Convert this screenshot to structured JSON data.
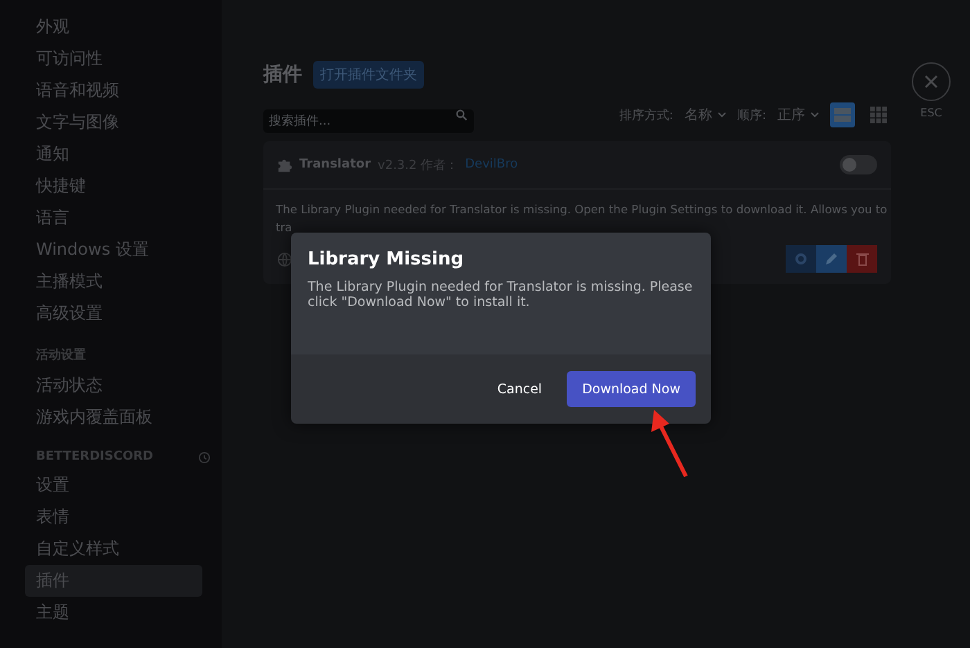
{
  "sidebar": {
    "groups": [
      {
        "items": [
          {
            "label": "外观",
            "selected": false
          },
          {
            "label": "可访问性",
            "selected": false
          },
          {
            "label": "语音和视频",
            "selected": false
          },
          {
            "label": "文字与图像",
            "selected": false
          },
          {
            "label": "通知",
            "selected": false
          },
          {
            "label": "快捷键",
            "selected": false
          },
          {
            "label": "语言",
            "selected": false
          },
          {
            "label": "Windows 设置",
            "selected": false
          },
          {
            "label": "主播模式",
            "selected": false
          },
          {
            "label": "高级设置",
            "selected": false
          }
        ]
      },
      {
        "header": "活动设置",
        "items": [
          {
            "label": "活动状态",
            "selected": false
          },
          {
            "label": "游戏内覆盖面板",
            "selected": false
          }
        ]
      },
      {
        "header": "BETTERDISCORD",
        "items": [
          {
            "label": "设置",
            "selected": false
          },
          {
            "label": "表情",
            "selected": false
          },
          {
            "label": "自定义样式",
            "selected": false
          },
          {
            "label": "插件",
            "selected": true
          },
          {
            "label": "主题",
            "selected": false
          }
        ]
      }
    ]
  },
  "page": {
    "title": "插件",
    "open_folder_button": "打开插件文件夹",
    "search": {
      "placeholder": "搜索插件..."
    },
    "sort": {
      "label": "排序方式:",
      "value": "名称"
    },
    "order": {
      "label": "顺序:",
      "value": "正序"
    },
    "views": [
      {
        "kind": "list",
        "selected": true
      },
      {
        "kind": "grid",
        "selected": false
      }
    ],
    "close": {
      "label": "ESC"
    },
    "plugin": {
      "name": "Translator",
      "meta": "v2.3.2 作者：",
      "author": "DevilBro",
      "enabled": false,
      "description": "The Library Plugin needed for Translator is missing. Open the Plugin Settings to download it. Allows you to",
      "description_line2": "tra"
    }
  },
  "dialog": {
    "title": "Library Missing",
    "message": "The Library Plugin needed for Translator is missing. Please click \"Download Now\" to install it.",
    "buttons": [
      {
        "label": "Cancel",
        "kind": "secondary"
      },
      {
        "label": "Download Now",
        "kind": "primary"
      }
    ]
  }
}
